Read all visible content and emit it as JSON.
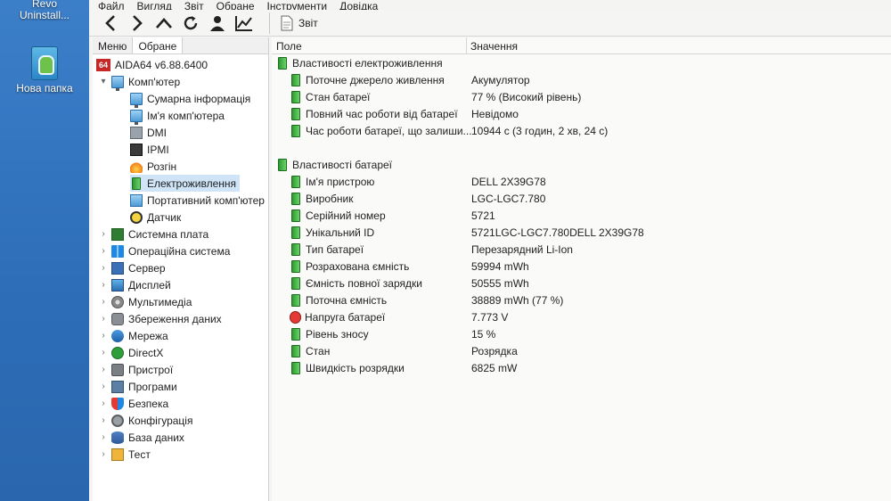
{
  "desktop": {
    "revo_label_1": "Revo",
    "revo_label_2": "Uninstall...",
    "folder_label": "Нова папка"
  },
  "menubar": [
    "Файл",
    "Вигляд",
    "Звіт",
    "Обране",
    "Інструменти",
    "Довідка"
  ],
  "toolbar": {
    "report_label": "Звіт"
  },
  "left_tabs": [
    "Меню",
    "Обране"
  ],
  "tree": {
    "root": "AIDA64 v6.88.6400",
    "root_badge": "64",
    "computer": "Комп'ютер",
    "computer_children": [
      "Сумарна інформація",
      "Ім'я комп'ютера",
      "DMI",
      "IPMI",
      "Розгін",
      "Електроживлення",
      "Портативний комп'ютер",
      "Датчик"
    ],
    "selected": "Електроживлення",
    "categories": [
      "Системна плата",
      "Операційна система",
      "Сервер",
      "Дисплей",
      "Мультимедіа",
      "Збереження даних",
      "Мережа",
      "DirectX",
      "Пристрої",
      "Програми",
      "Безпека",
      "Конфігурація",
      "База даних",
      "Тест"
    ]
  },
  "columns": {
    "field": "Поле",
    "value": "Значення"
  },
  "sections": [
    {
      "title": "Властивості електроживлення",
      "rows": [
        {
          "field": "Поточне джерело живлення",
          "value": "Акумулятор"
        },
        {
          "field": "Стан батареї",
          "value": "77 % (Високий рівень)"
        },
        {
          "field": "Повний час роботи від батареї",
          "value": "Невідомо"
        },
        {
          "field": "Час роботи батареї, що залиши...",
          "value": "10944 с (3 годин, 2 хв, 24 с)"
        }
      ]
    },
    {
      "title": "Властивості батареї",
      "rows": [
        {
          "field": "Ім'я пристрою",
          "value": "DELL 2X39G78"
        },
        {
          "field": "Виробник",
          "value": "LGC-LGC7.780"
        },
        {
          "field": "Серійний номер",
          "value": "5721"
        },
        {
          "field": "Унікальний ID",
          "value": "5721LGC-LGC7.780DELL 2X39G78"
        },
        {
          "field": "Тип батареї",
          "value": "Перезарядний Li-Ion"
        },
        {
          "field": "Розрахована ємність",
          "value": "59994 mWh"
        },
        {
          "field": "Ємність повної зарядки",
          "value": "50555 mWh"
        },
        {
          "field": "Поточна ємність",
          "value": "38889 mWh  (77 %)"
        },
        {
          "field": "Напруга батареї",
          "value": "7.773 V"
        },
        {
          "field": "Рівень зносу",
          "value": "15 %"
        },
        {
          "field": "Стан",
          "value": "Розрядка"
        },
        {
          "field": "Швидкість розрядки",
          "value": "6825 mW"
        }
      ]
    }
  ]
}
